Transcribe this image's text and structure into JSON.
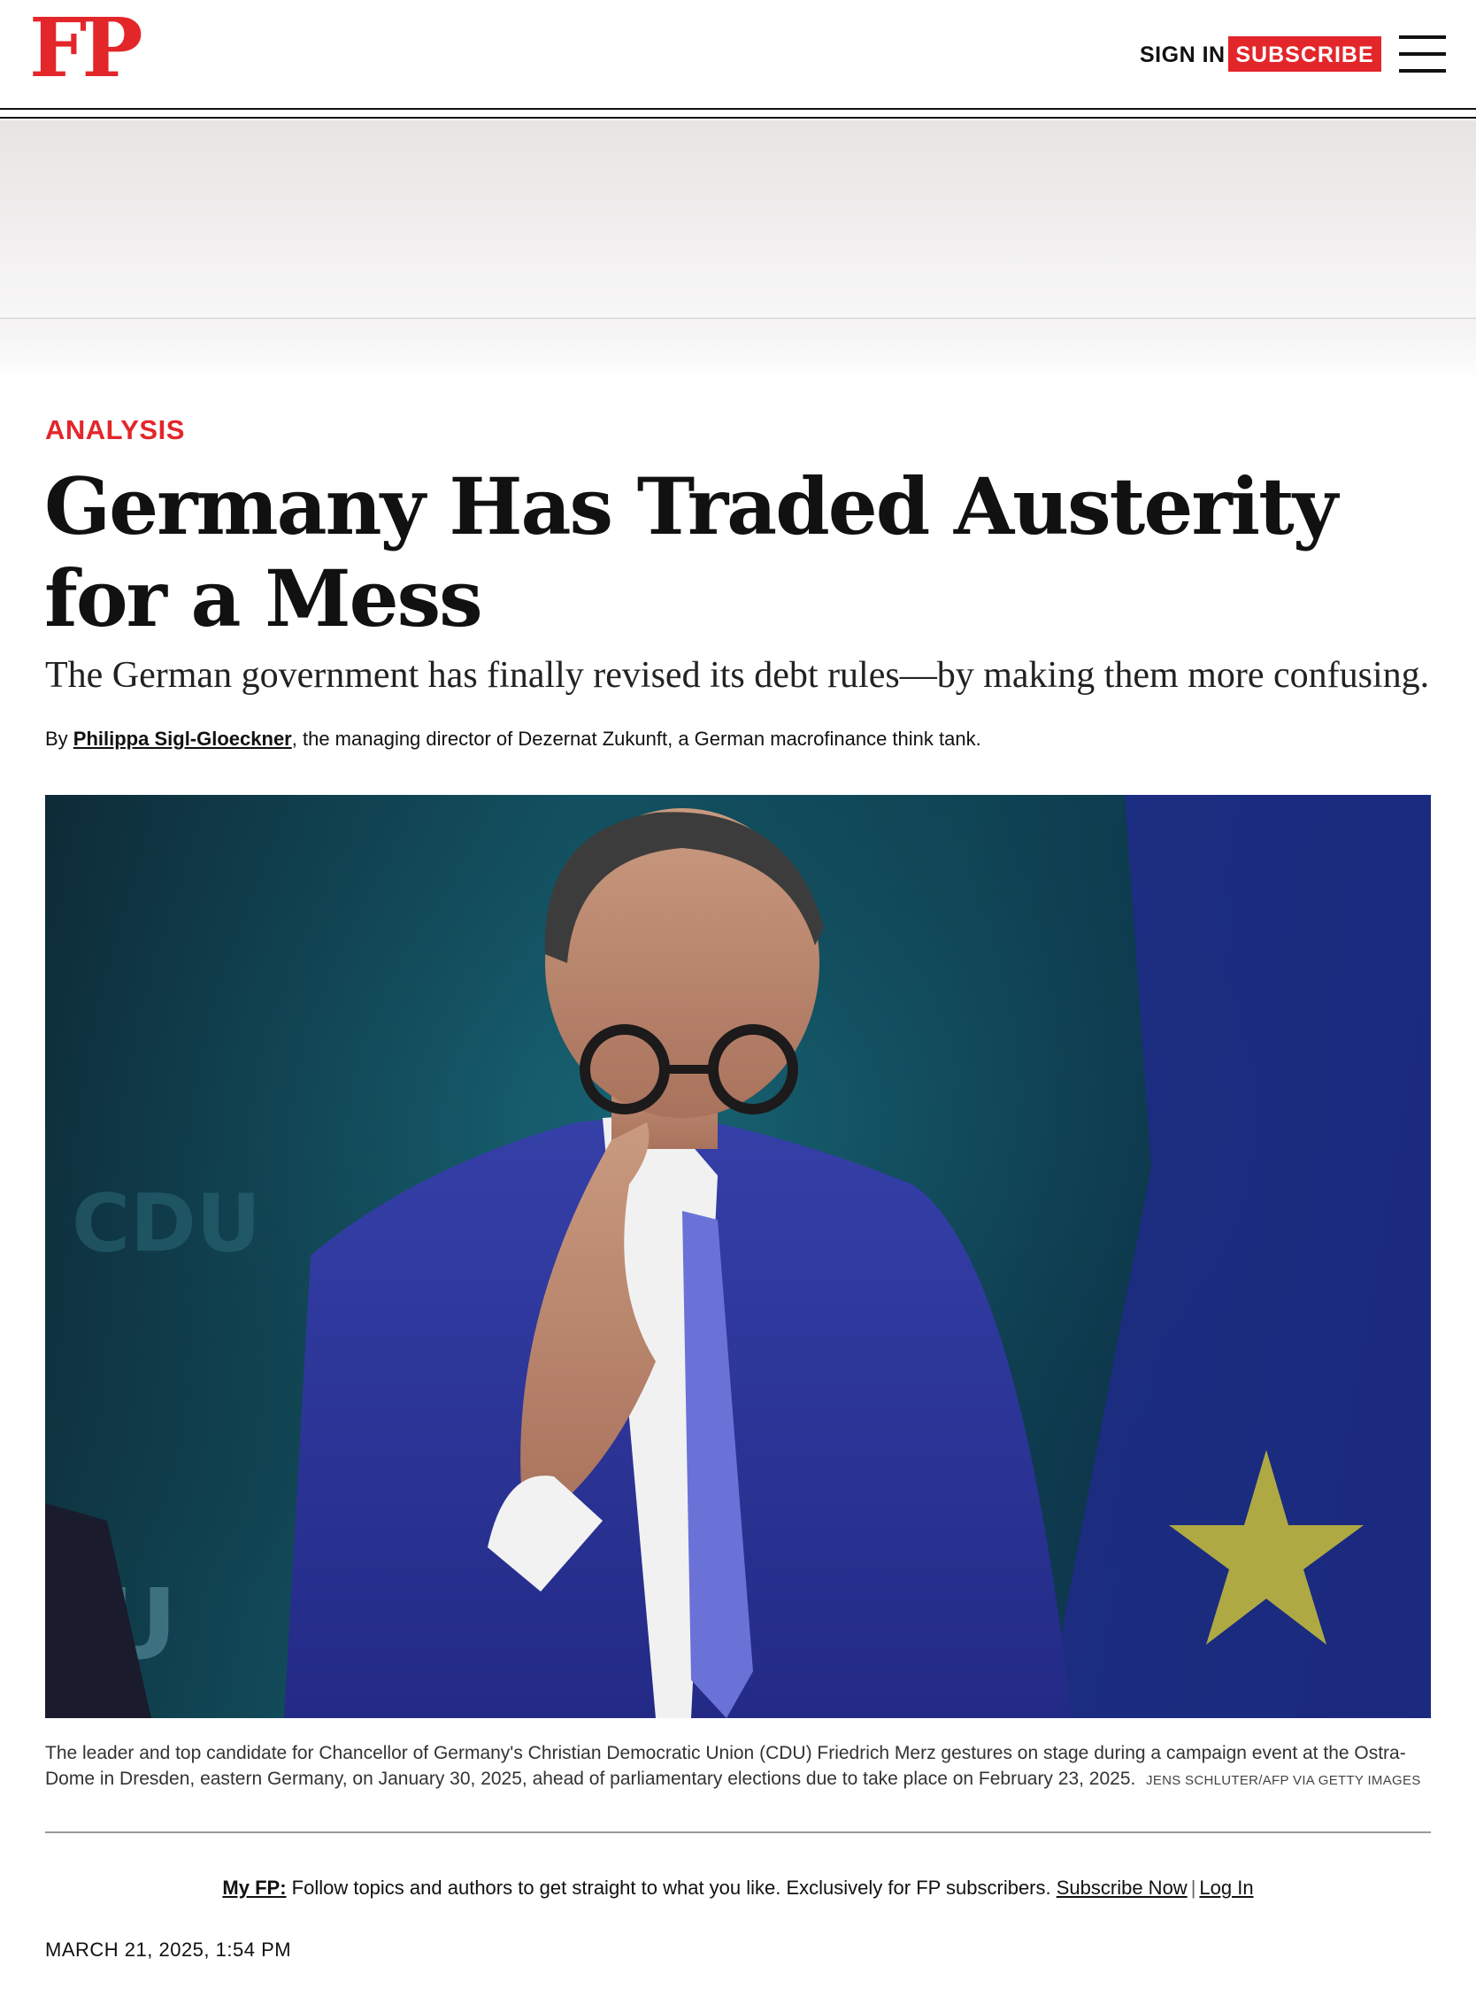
{
  "header": {
    "logo": "FP",
    "sign_in": "SIGN IN",
    "subscribe": "SUBSCRIBE"
  },
  "article": {
    "kicker": "ANALYSIS",
    "headline": "Germany Has Traded Austerity for a Mess",
    "dek": "The German government has finally revised its debt rules—by making them more confusing.",
    "byline_prefix": "By ",
    "author": "Philippa Sigl-Gloeckner",
    "author_desc": ", the managing director of Dezernat Zukunft, a German macrofinance think tank.",
    "image_caption": "The leader and top candidate for Chancellor of Germany's Christian Democratic Union (CDU) Friedrich Merz gestures on stage during a campaign event at the Ostra-Dome in Dresden, eastern Germany, on January 30, 2025, ahead of parliamentary elections due to take place on February 23, 2025.",
    "image_credit": "JENS SCHLUTER/AFP VIA GETTY IMAGES",
    "backdrop_text_1": "CDU",
    "backdrop_text_2": "U",
    "date": "MARCH 21, 2025, 1:54 PM"
  },
  "myfp": {
    "label": "My FP:",
    "text": " Follow topics and authors to get straight to what you like. Exclusively for FP subscribers. ",
    "subscribe_link": "Subscribe Now",
    "separator": "|",
    "login_link": "Log In"
  },
  "colors": {
    "brand_red": "#e3262a",
    "text": "#111111"
  },
  "icons": {
    "menu": "hamburger-menu-icon"
  }
}
